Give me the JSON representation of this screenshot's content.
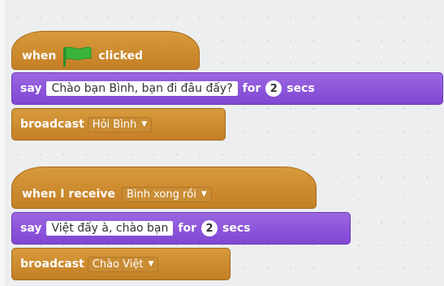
{
  "script1": {
    "hat": {
      "when": "when",
      "clicked": "clicked",
      "flag_icon": "green-flag",
      "flag_color": "#3ab43a"
    },
    "say": {
      "say": "say",
      "text": "Chào bạn Bình, bạn đi đâu đấy?",
      "for": "for",
      "secs_value": "2",
      "secs": "secs"
    },
    "broadcast": {
      "label": "broadcast",
      "message": "Hỏi Bình"
    }
  },
  "script2": {
    "hat": {
      "label": "when I receive",
      "message": "Bình xong rồi"
    },
    "say": {
      "say": "say",
      "text": "Việt đấy à, chào bạn",
      "for": "for",
      "secs_value": "2",
      "secs": "secs"
    },
    "broadcast": {
      "label": "broadcast",
      "message": "Chào Việt"
    }
  },
  "colors": {
    "events": "#c88330",
    "looks": "#8a55d7",
    "background": "#eceeef"
  }
}
